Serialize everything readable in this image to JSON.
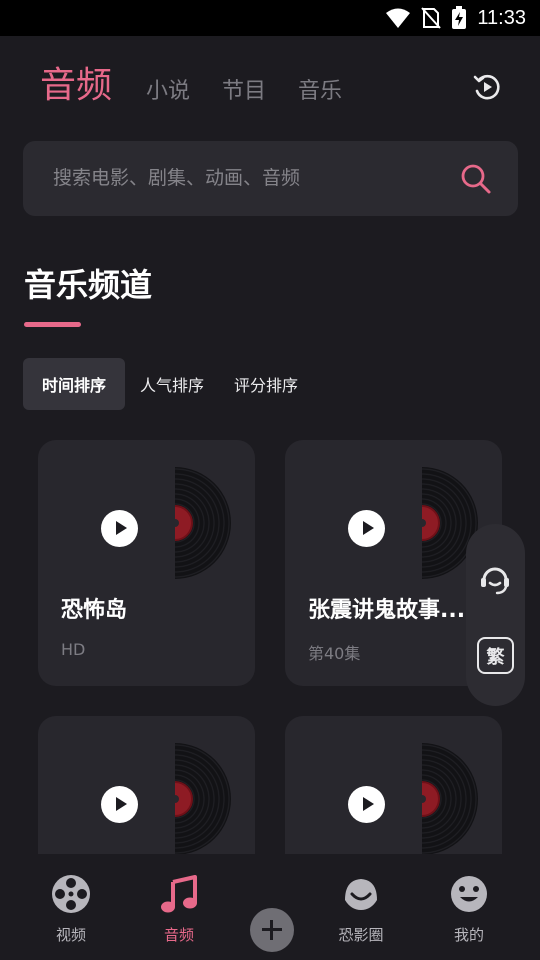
{
  "status_bar": {
    "time": "11:33"
  },
  "header": {
    "tabs": [
      {
        "label": "音频",
        "active": true
      },
      {
        "label": "小说",
        "active": false
      },
      {
        "label": "节目",
        "active": false
      },
      {
        "label": "音乐",
        "active": false
      }
    ],
    "history_icon": "play-history-icon"
  },
  "search": {
    "placeholder": "搜索电影、剧集、动画、音频",
    "icon": "search-icon"
  },
  "section": {
    "title": "音乐频道"
  },
  "sort": {
    "items": [
      "时间排序",
      "人气排序",
      "评分排序"
    ],
    "active_index": 0
  },
  "cards": [
    {
      "title": "恐怖岛",
      "subtitle": "HD"
    },
    {
      "title": "张震讲鬼故事...",
      "subtitle": "第40集"
    },
    {
      "title": "",
      "subtitle": ""
    },
    {
      "title": "",
      "subtitle": ""
    }
  ],
  "float_panel": {
    "support_icon": "customer-service-icon",
    "traditional_label": "繁"
  },
  "bottom_nav": {
    "items": [
      {
        "label": "视频",
        "icon": "film-reel-icon",
        "active": false
      },
      {
        "label": "音频",
        "icon": "music-note-icon",
        "active": true
      },
      {
        "label": "",
        "icon": "add-icon",
        "active": false
      },
      {
        "label": "恐影圈",
        "icon": "community-icon",
        "active": false
      },
      {
        "label": "我的",
        "icon": "smiley-icon",
        "active": false
      }
    ]
  },
  "colors": {
    "accent": "#e7698a",
    "background": "#1c1b20",
    "card": "#28272d",
    "muted": "#7c7b82"
  }
}
